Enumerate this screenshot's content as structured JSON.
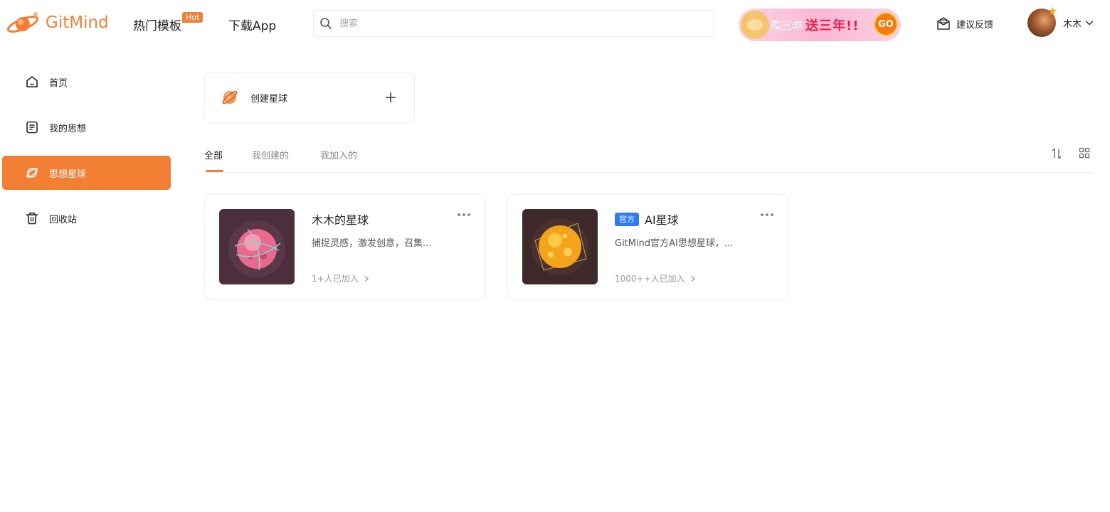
{
  "header": {
    "logo_text": "GitMind",
    "nav": {
      "templates_label": "热门模板",
      "hot_badge": "Hot",
      "download_label": "下载App"
    },
    "search": {
      "placeholder": "搜索",
      "value": ""
    },
    "promo": {
      "text_main": "买三年",
      "text_accent": "送三年!!",
      "go_label": "GO"
    },
    "feedback_label": "建议反馈",
    "user": {
      "name": "木木"
    }
  },
  "sidebar": {
    "items": [
      {
        "label": "首页",
        "icon": "home-icon"
      },
      {
        "label": "我的思想",
        "icon": "document-icon"
      },
      {
        "label": "思想星球",
        "icon": "planet-icon",
        "active": true
      },
      {
        "label": "回收站",
        "icon": "trash-icon"
      }
    ]
  },
  "main": {
    "create_label": "创建星球",
    "tabs": [
      {
        "label": "全部",
        "active": true
      },
      {
        "label": "我创建的"
      },
      {
        "label": "我加入的"
      }
    ],
    "planets": [
      {
        "title": "木木的星球",
        "official": false,
        "description": "捕捉灵感，激发创意，召集...",
        "members": "1+人已加入"
      },
      {
        "title": "AI星球",
        "official": true,
        "badge": "官方",
        "description": "GitMind官方AI思想星球，...",
        "members": "1000++人已加入"
      }
    ]
  },
  "colors": {
    "accent": "#f37f35",
    "official_badge": "#2f7bf3",
    "text_primary": "#222222",
    "text_muted": "#888888"
  }
}
